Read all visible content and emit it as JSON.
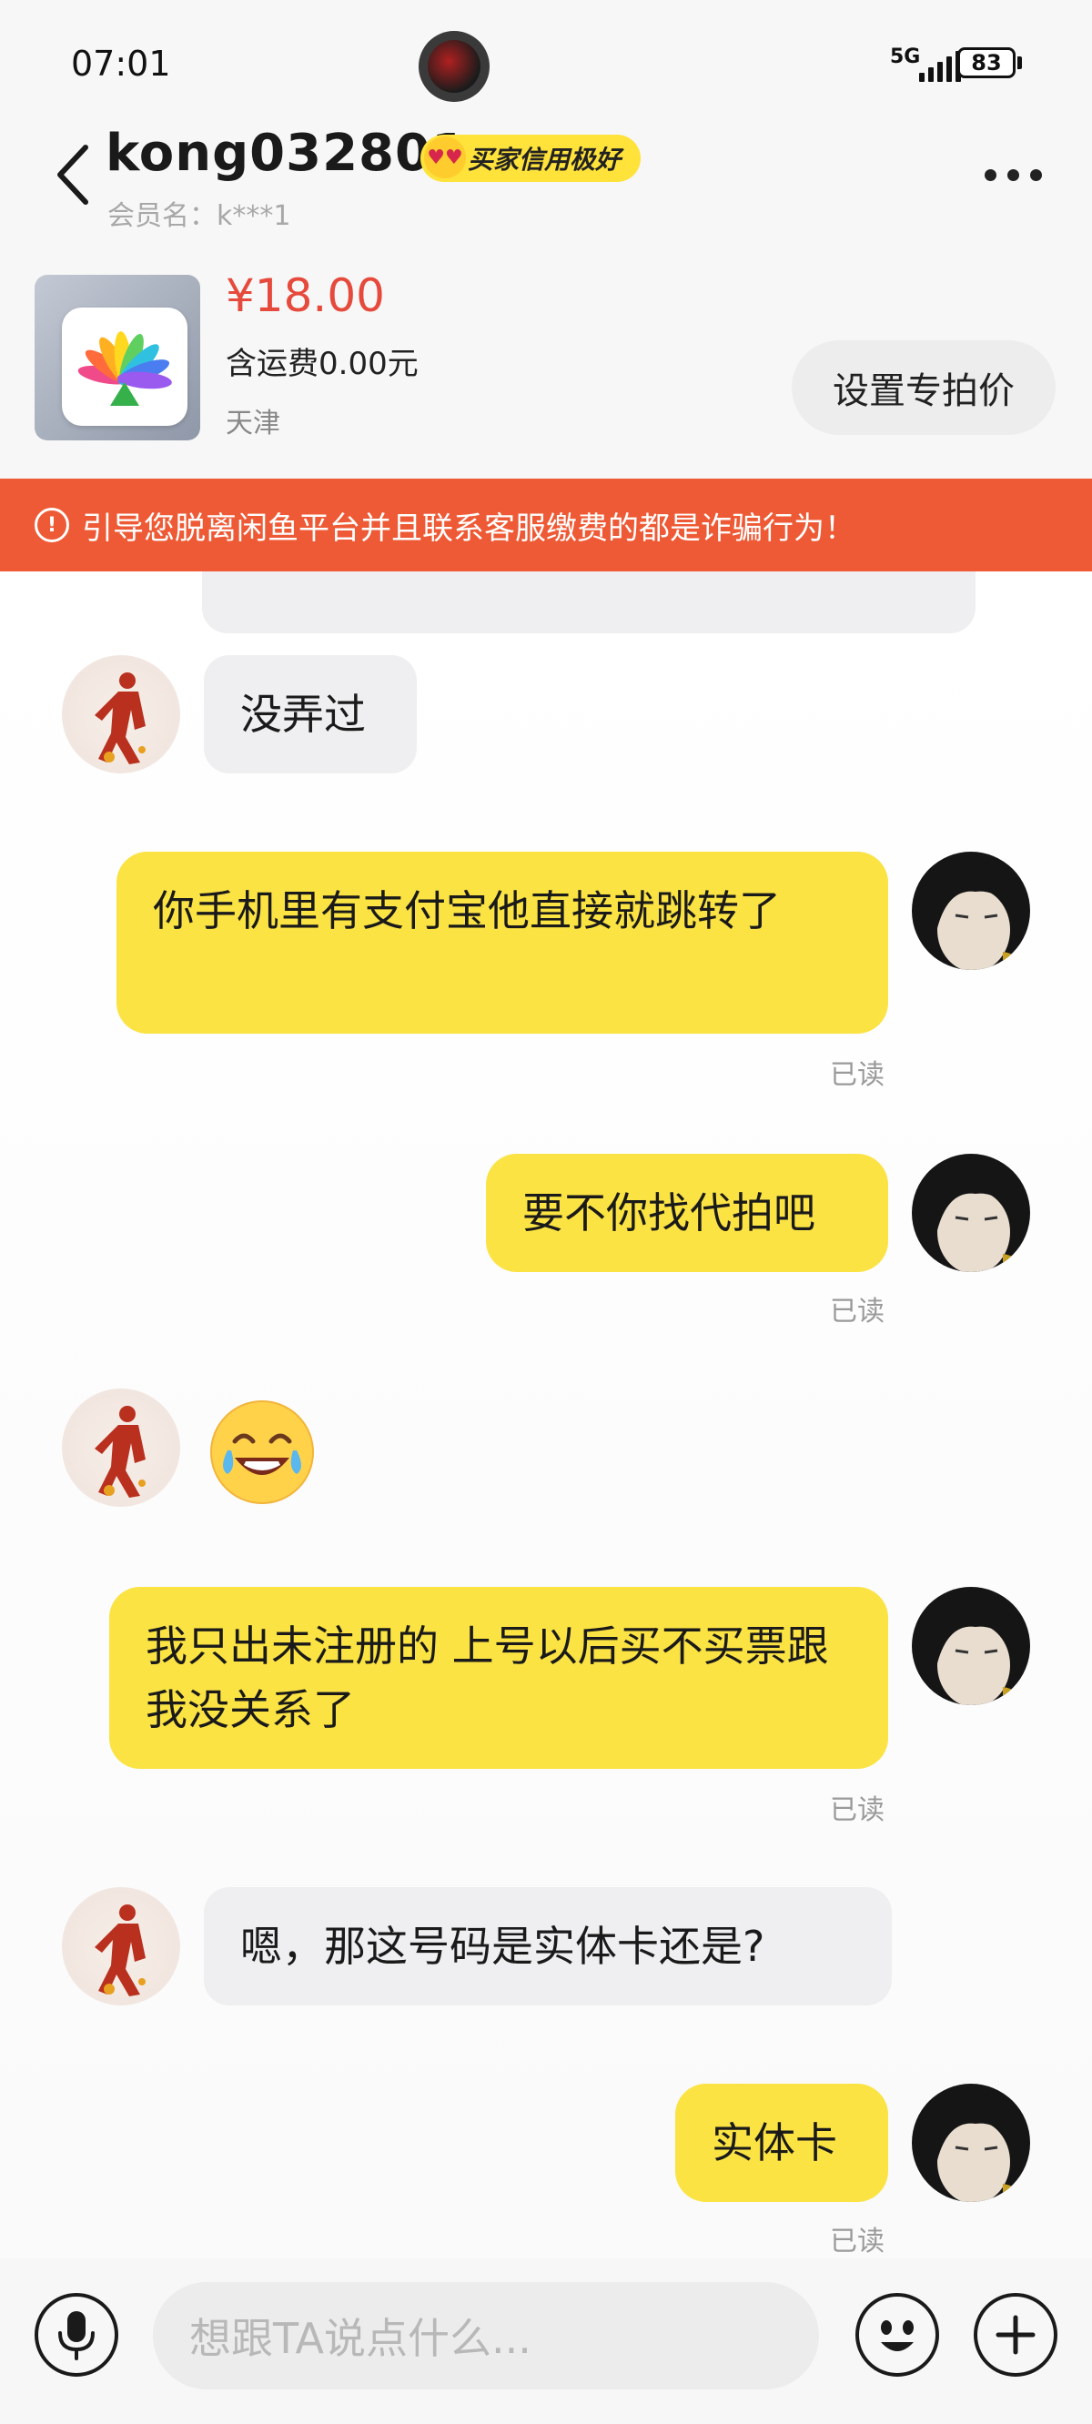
{
  "status_bar": {
    "time": "07:01",
    "network": "5G",
    "battery": "83"
  },
  "header": {
    "seller_name": "kong032801",
    "credit_badge": "买家信用极好",
    "member_label": "会员名：k***1",
    "back_icon": "chevron-left-icon",
    "more_icon": "more-dots-icon"
  },
  "product": {
    "price": "¥18.00",
    "shipping": "含运费0.00元",
    "location": "天津",
    "set_price_button": "设置专拍价"
  },
  "warning_banner": {
    "text": "引导您脱离闲鱼平台并且联系客服缴费的都是诈骗行为！",
    "icon": "exclamation-circle-icon"
  },
  "messages": [
    {
      "side": "left",
      "text": "没弄过"
    },
    {
      "side": "right",
      "text": "你手机里有支付宝他直接就跳转了",
      "status": "已读"
    },
    {
      "side": "right",
      "text": "要不你找代拍吧",
      "status": "已读"
    },
    {
      "side": "left",
      "text": "😂"
    },
    {
      "side": "right",
      "text": "我只出未注册的 上号以后买不买票跟我没关系了",
      "status": "已读"
    },
    {
      "side": "left",
      "text": "嗯，那这号码是实体卡还是?"
    },
    {
      "side": "right",
      "text": "实体卡",
      "status": "已读"
    }
  ],
  "input_bar": {
    "placeholder": "想跟TA说点什么...",
    "mic_icon": "microphone-icon",
    "emoji_icon": "smiley-icon",
    "plus_icon": "plus-icon"
  },
  "colors": {
    "accent_yellow": "#fbe344",
    "warning_orange": "#ee5a35",
    "price_red": "#e64a3c"
  }
}
